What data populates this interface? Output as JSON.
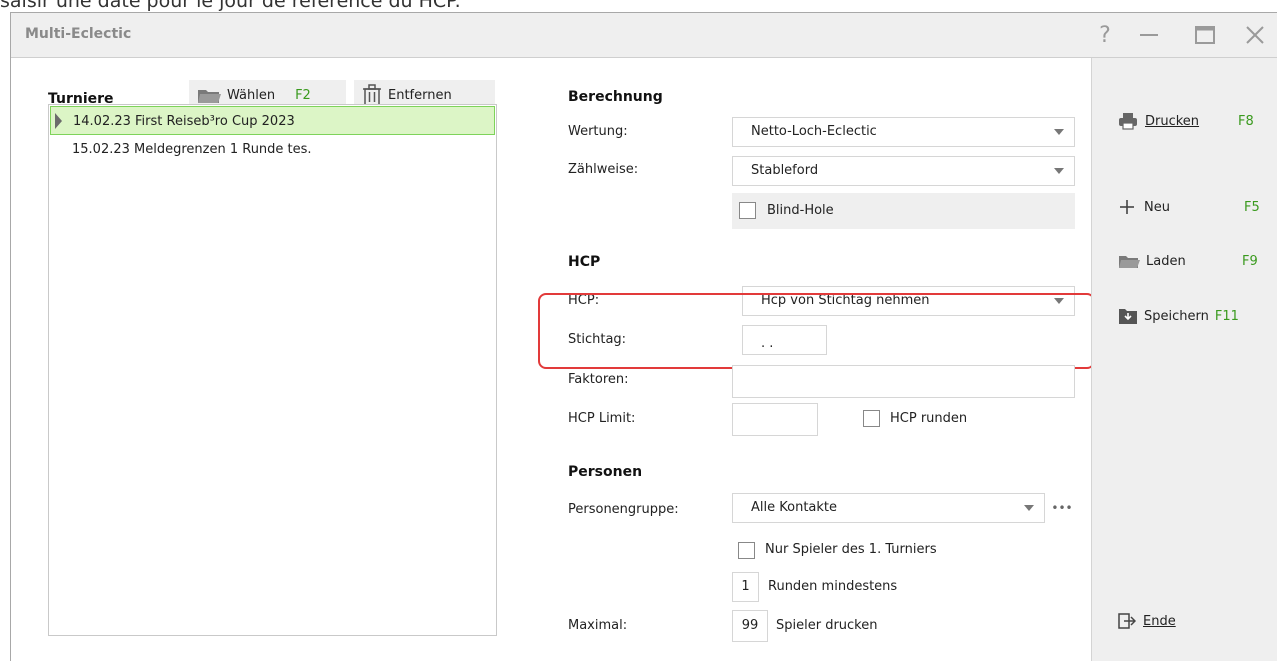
{
  "caption": "saisir une date pour le jour de référence du HCP.",
  "window": {
    "title": "Multi-Eclectic"
  },
  "turniere": {
    "heading": "Turniere",
    "choose_label": "Wählen",
    "choose_key": "F2",
    "remove_label": "Entfernen",
    "items": [
      {
        "label": "14.02.23 First Reiseb³ro Cup 2023",
        "selected": true
      },
      {
        "label": "15.02.23 Meldegrenzen 1 Runde tes.",
        "selected": false
      }
    ]
  },
  "berechnung": {
    "heading": "Berechnung",
    "wertung_label": "Wertung:",
    "wertung_value": "Netto-Loch-Eclectic",
    "zaehlweise_label": "Zählweise:",
    "zaehlweise_value": "Stableford",
    "blind_hole_label": "Blind-Hole"
  },
  "hcp": {
    "heading": "HCP",
    "hcp_label": "HCP:",
    "hcp_value": "Hcp von Stichtag nehmen",
    "stichtag_label": "Stichtag:",
    "stichtag_value": ". .",
    "faktoren_label": "Faktoren:",
    "faktoren_value": "",
    "limit_label": "HCP Limit:",
    "limit_value": "",
    "runden_label": "HCP runden"
  },
  "personen": {
    "heading": "Personen",
    "gruppe_label": "Personengruppe:",
    "gruppe_value": "Alle Kontakte",
    "more_label": "•••",
    "nur_spieler_label": "Nur Spieler des 1. Turniers",
    "runden_value": "1",
    "runden_label": "Runden mindestens",
    "maximal_label": "Maximal:",
    "maximal_value": "99",
    "maximal_suffix": "Spieler drucken"
  },
  "sidebar": {
    "drucken_label": "Drucken",
    "drucken_key": "F8",
    "neu_label": "Neu",
    "neu_key": "F5",
    "laden_label": "Laden",
    "laden_key": "F9",
    "speichern_label": "Speichern",
    "speichern_key": "F11",
    "ende_label": "Ende"
  },
  "colors": {
    "fkey": "#3a9a1e",
    "highlight": "#e23a3a",
    "selected_bg": "#dcf5c6",
    "selected_border": "#7ed35a"
  }
}
